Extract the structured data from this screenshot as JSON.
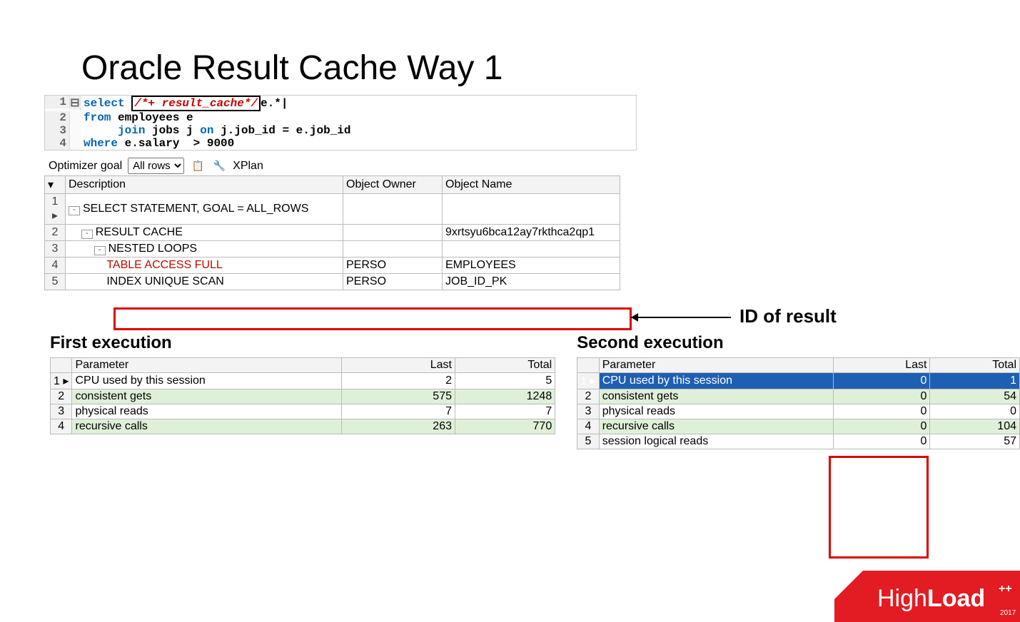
{
  "title": "Oracle Result Cache Way 1",
  "sql": {
    "line1_kw": "select",
    "line1_hint": "/*+ result_cache*/",
    "line1_rest": "e.*",
    "line2": "from employees e",
    "line3": "     join jobs j on j.job_id = e.job_id",
    "line4": "where e.salary  > 9000"
  },
  "toolbar": {
    "optimizer_label": "Optimizer goal",
    "optimizer_value": "All rows",
    "xplan": "XPlan"
  },
  "plan": {
    "headers": {
      "desc": "Description",
      "owner": "Object Owner",
      "name": "Object Name"
    },
    "rows": [
      {
        "n": "1",
        "desc": "SELECT STATEMENT, GOAL = ALL_ROWS",
        "owner": "",
        "name": "",
        "indent": 0,
        "toggle": "-",
        "arrow": true
      },
      {
        "n": "2",
        "desc": "RESULT CACHE",
        "owner": "",
        "name": "9xrtsyu6bca12ay7rkthca2qp1",
        "indent": 1,
        "toggle": "-"
      },
      {
        "n": "3",
        "desc": "NESTED LOOPS",
        "owner": "",
        "name": "",
        "indent": 2,
        "toggle": "-"
      },
      {
        "n": "4",
        "desc": "TABLE ACCESS FULL",
        "owner": "PERSO",
        "name": "EMPLOYEES",
        "indent": 3,
        "red": true
      },
      {
        "n": "5",
        "desc": "INDEX UNIQUE SCAN",
        "owner": "PERSO",
        "name": "JOB_ID_PK",
        "indent": 3
      }
    ]
  },
  "annotation": "ID of result",
  "first": {
    "title": "First execution",
    "headers": {
      "param": "Parameter",
      "last": "Last",
      "total": "Total"
    },
    "rows": [
      {
        "n": "1",
        "param": "CPU used by this session",
        "last": "2",
        "total": "5",
        "green": false,
        "arrow": true
      },
      {
        "n": "2",
        "param": "consistent gets",
        "last": "575",
        "total": "1248",
        "green": true
      },
      {
        "n": "3",
        "param": "physical reads",
        "last": "7",
        "total": "7",
        "green": false
      },
      {
        "n": "4",
        "param": "recursive calls",
        "last": "263",
        "total": "770",
        "green": true
      }
    ]
  },
  "second": {
    "title": "Second execution",
    "headers": {
      "param": "Parameter",
      "last": "Last",
      "total": "Total"
    },
    "rows": [
      {
        "n": "1",
        "param": "CPU used by this session",
        "last": "0",
        "total": "1",
        "sel": true,
        "arrow": true
      },
      {
        "n": "2",
        "param": "consistent gets",
        "last": "0",
        "total": "54",
        "green": true
      },
      {
        "n": "3",
        "param": "physical reads",
        "last": "0",
        "total": "0"
      },
      {
        "n": "4",
        "param": "recursive calls",
        "last": "0",
        "total": "104",
        "green": true
      },
      {
        "n": "5",
        "param": "session logical reads",
        "last": "0",
        "total": "57"
      }
    ]
  },
  "logo_parts": {
    "pre": "High",
    "bold": "Load",
    "suffix": "++",
    "year": "2017"
  }
}
